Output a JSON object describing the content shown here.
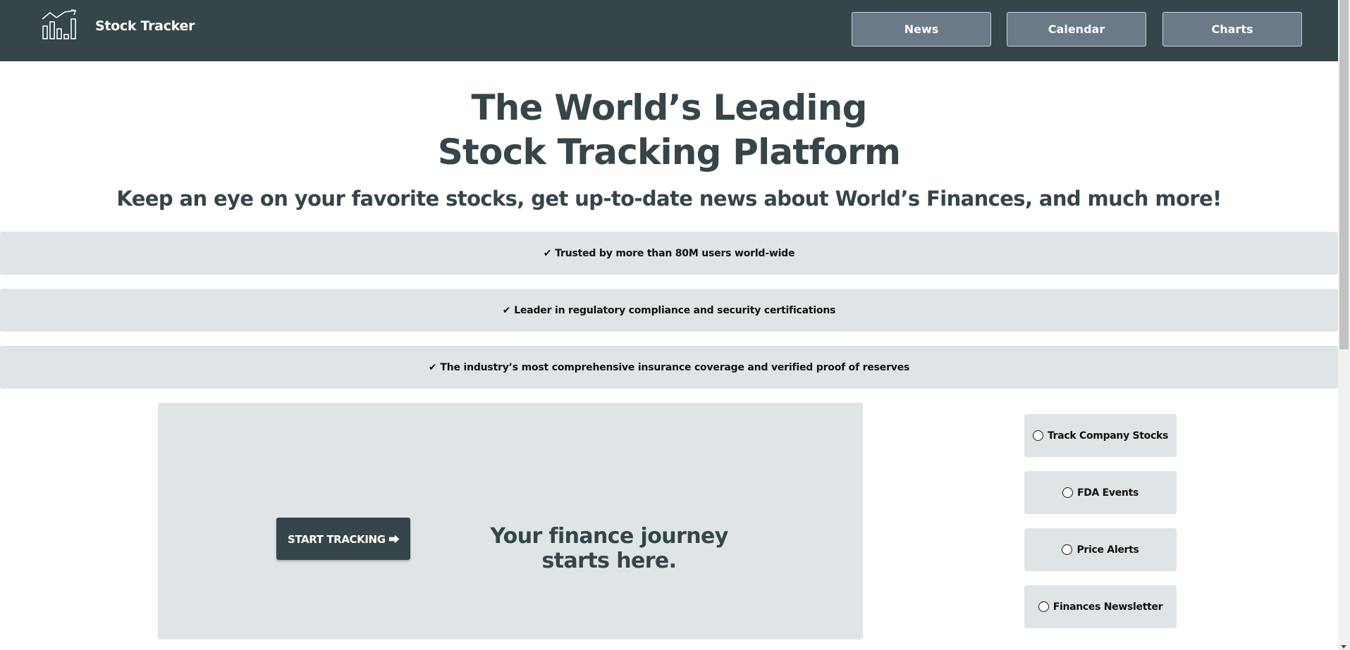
{
  "nav": {
    "brand": "Stock Tracker",
    "links": [
      "News",
      "Calendar",
      "Charts"
    ]
  },
  "hero": {
    "title_line1": "The World’s Leading",
    "title_line2": "Stock Tracking Platform",
    "subtitle": "Keep an eye on your favorite stocks, get up-to-date news about World’s Finances, and much more!"
  },
  "features": [
    {
      "check": "✔",
      "text": "Trusted by more than 80M users world-wide"
    },
    {
      "check": "✔",
      "text": "Leader in regulatory compliance and security certifications"
    },
    {
      "check": "✔",
      "text": "The industry’s most comprehensive insurance coverage and verified proof of reserves"
    }
  ],
  "cta": {
    "button_label": "START TRACKING ⮕",
    "tagline": "Your finance journey starts here."
  },
  "options": [
    {
      "label": "Track Company Stocks",
      "selected": false
    },
    {
      "label": "FDA Events",
      "selected": false
    },
    {
      "label": "Price Alerts",
      "selected": false
    },
    {
      "label": "Finances Newsletter",
      "selected": false
    }
  ],
  "icons": {
    "logo": "bar-chart-trend-icon",
    "check": "check-icon",
    "radio": "radio-unchecked-icon"
  },
  "colors": {
    "primary": "#354549",
    "nav_button": "#6c7a87",
    "panel": "#dfe5e7",
    "background": "#ffffff"
  }
}
